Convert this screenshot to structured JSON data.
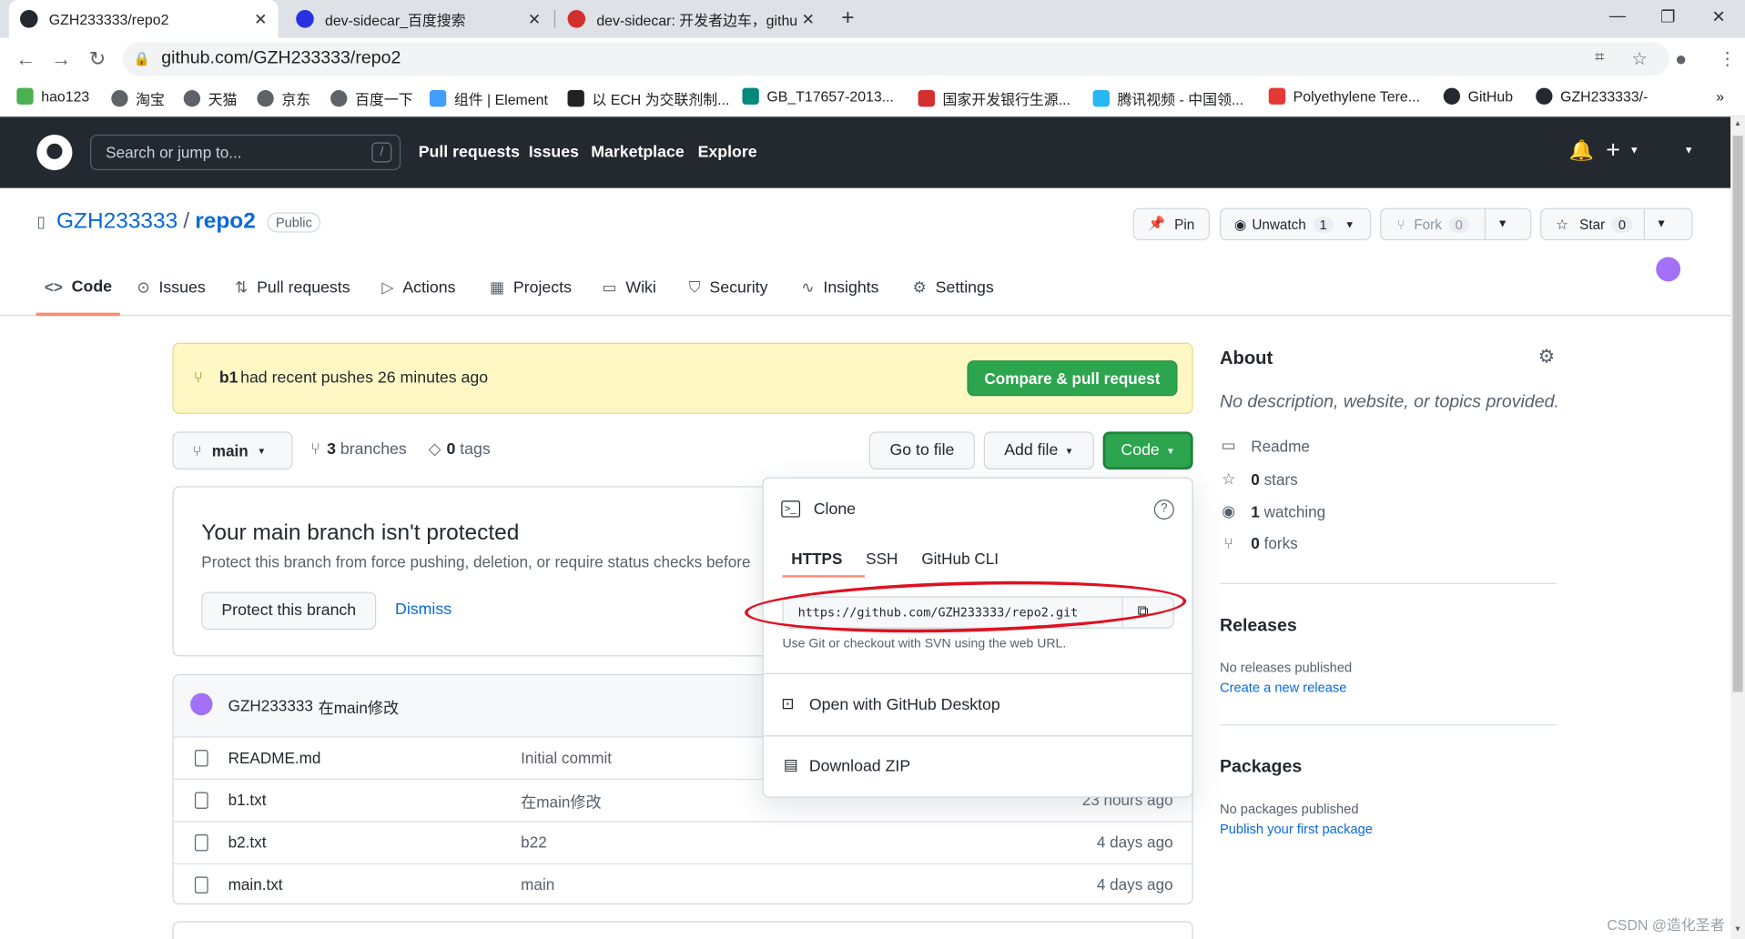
{
  "browser": {
    "tabs": [
      {
        "title": "GZH233333/repo2"
      },
      {
        "title": "dev-sidecar_百度搜索"
      },
      {
        "title": "dev-sidecar: 开发者边车，githu"
      }
    ],
    "url": "github.com/GZH233333/repo2",
    "bookmarks": [
      "hao123",
      "淘宝",
      "天猫",
      "京东",
      "百度一下",
      "组件 | Element",
      "以 ECH 为交联剂制...",
      "GB_T17657-2013...",
      "国家开发银行生源...",
      "腾讯视频 - 中国领...",
      "Polyethylene Tere...",
      "GitHub",
      "GZH233333/-"
    ],
    "more_bookmarks": "»"
  },
  "header": {
    "search_placeholder": "Search or jump to...",
    "search_key": "/",
    "nav": [
      "Pull requests",
      "Issues",
      "Marketplace",
      "Explore"
    ]
  },
  "repo": {
    "owner": "GZH233333",
    "sep": "/",
    "name": "repo2",
    "visibility": "Public",
    "pin": "Pin",
    "unwatch": "Unwatch",
    "watch_count": "1",
    "fork": "Fork",
    "fork_count": "0",
    "star": "Star",
    "star_count": "0"
  },
  "repo_nav": [
    "Code",
    "Issues",
    "Pull requests",
    "Actions",
    "Projects",
    "Wiki",
    "Security",
    "Insights",
    "Settings"
  ],
  "flash": {
    "branch": "b1",
    "text": "had recent pushes 26 minutes ago",
    "button": "Compare & pull request"
  },
  "toolbar": {
    "branch": "main",
    "branches_count": "3",
    "branches_label": "branches",
    "tags_count": "0",
    "tags_label": "tags",
    "go_to_file": "Go to file",
    "add_file": "Add file",
    "code": "Code"
  },
  "protect": {
    "title": "Your main branch isn't protected",
    "desc": "Protect this branch from force pushing, deletion, or require status checks before",
    "protect_button": "Protect this branch",
    "dismiss": "Dismiss"
  },
  "commit": {
    "author": "GZH233333",
    "message": "在main修改"
  },
  "files": [
    {
      "name": "README.md",
      "message": "Initial commit",
      "time": ""
    },
    {
      "name": "b1.txt",
      "message": "在main修改",
      "time": "23 hours ago"
    },
    {
      "name": "b2.txt",
      "message": "b22",
      "time": "4 days ago"
    },
    {
      "name": "main.txt",
      "message": "main",
      "time": "4 days ago"
    }
  ],
  "clone": {
    "title": "Clone",
    "tabs": [
      "HTTPS",
      "SSH",
      "GitHub CLI"
    ],
    "url": "https://github.com/GZH233333/repo2.git",
    "hint": "Use Git or checkout with SVN using the web URL.",
    "desktop": "Open with GitHub Desktop",
    "zip": "Download ZIP"
  },
  "about": {
    "title": "About",
    "desc": "No description, website, or topics provided.",
    "readme": "Readme",
    "stars": "0",
    "stars_label": "stars",
    "watching": "1",
    "watching_label": "watching",
    "forks": "0",
    "forks_label": "forks"
  },
  "releases": {
    "title": "Releases",
    "none": "No releases published",
    "link": "Create a new release"
  },
  "packages": {
    "title": "Packages",
    "none": "No packages published",
    "link": "Publish your first package"
  },
  "watermark": "CSDN @造化圣者",
  "colors": {
    "accent": "#0969da",
    "green": "#2da44e",
    "header": "#24292f",
    "annotation": "#e01020"
  }
}
